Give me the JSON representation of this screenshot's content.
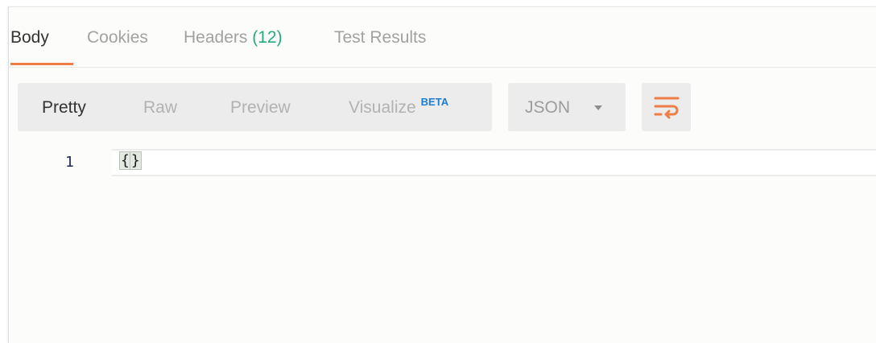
{
  "response_tabs": [
    {
      "label": "Body",
      "active": true
    },
    {
      "label": "Cookies",
      "active": false
    },
    {
      "label": "Headers",
      "count": "(12)",
      "active": false
    },
    {
      "label": "Test Results",
      "active": false
    }
  ],
  "view_modes": [
    {
      "label": "Pretty",
      "active": true
    },
    {
      "label": "Raw",
      "active": false
    },
    {
      "label": "Preview",
      "active": false
    },
    {
      "label": "Visualize",
      "badge": "BETA",
      "active": false
    }
  ],
  "format": {
    "selected": "JSON"
  },
  "editor": {
    "lines": [
      {
        "number": "1",
        "code_open": "{",
        "code_close": "}"
      }
    ]
  },
  "colors": {
    "accent": "#ee7d48",
    "count": "#27a87e",
    "beta": "#1a7dd6"
  },
  "icons": {
    "wrap": "word-wrap-icon",
    "dropdown": "caret-down-icon"
  }
}
